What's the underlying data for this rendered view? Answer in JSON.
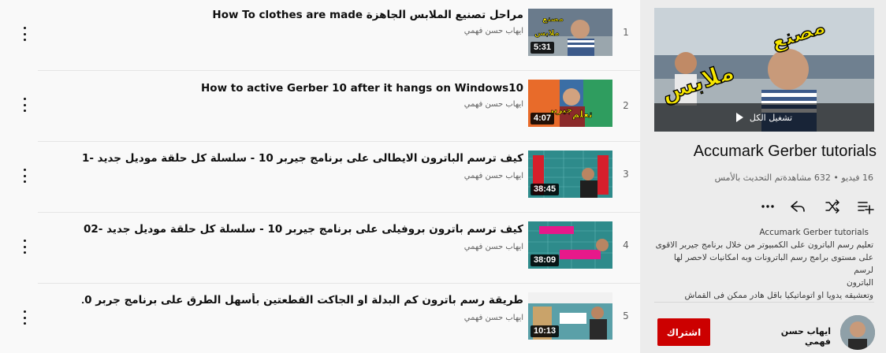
{
  "videos": [
    {
      "index": "1",
      "title": "مراحل تصنيع الملابس الجاهزة How To clothes are made",
      "channel": "ايهاب حسن فهمي",
      "duration": "5:31"
    },
    {
      "index": "2",
      "title": "How to active Gerber 10 after it hangs on Windows10",
      "channel": "ايهاب حسن فهمي",
      "duration": "4:07"
    },
    {
      "index": "3",
      "title": "كيف ترسم الباترون الايطالى على برنامج جيربر 10 - سلسلة كل حلقة موديل جديد -01",
      "channel": "ايهاب حسن فهمي",
      "duration": "38:45"
    },
    {
      "index": "4",
      "title": "كيف ترسم باترون بروفيلى على برنامج جيربر 10 - سلسلة كل حلقة موديل جديد -02",
      "channel": "ايهاب حسن فهمي",
      "duration": "38:09"
    },
    {
      "index": "5",
      "title": "طريقة رسم باترون كم البدلة او الجاكت القطعتين بأسهل الطرق على برنامج جربر 10",
      "channel": "ايهاب حسن فهمي",
      "duration": "10:13"
    }
  ],
  "playlist": {
    "play_all": "تشغيل الكل",
    "title": "Accumark Gerber tutorials",
    "stats": "16 فيديو • 632 مشاهدةتم التحديث بالأمس",
    "description_title": "Accumark Gerber tutorials",
    "description_lines": [
      "تعليم رسم الباترون على الكمبيوتر من خلال برنامج جيربر الاقوى",
      "على مستوى برامج رسم الباترونات وبه امكانيات لاحصر لها لرسم",
      "الباترون",
      "وتعشيقه يدويا او اتوماتيكيا باقل هادر ممكن فى القماش"
    ],
    "owner_name": "ايهاب حسن فهمي",
    "subscribe_label": "اشتراك"
  },
  "icons": {
    "more": "more-vert-icon",
    "share": "share-icon",
    "shuffle": "shuffle-icon",
    "add_to_queue": "playlist-add-icon",
    "play": "play-icon"
  },
  "colors": {
    "accent": "#cc0000",
    "background": "#f9f9f9",
    "sidebar": "#ececec",
    "thumb_text_yellow": "#f7e600"
  }
}
